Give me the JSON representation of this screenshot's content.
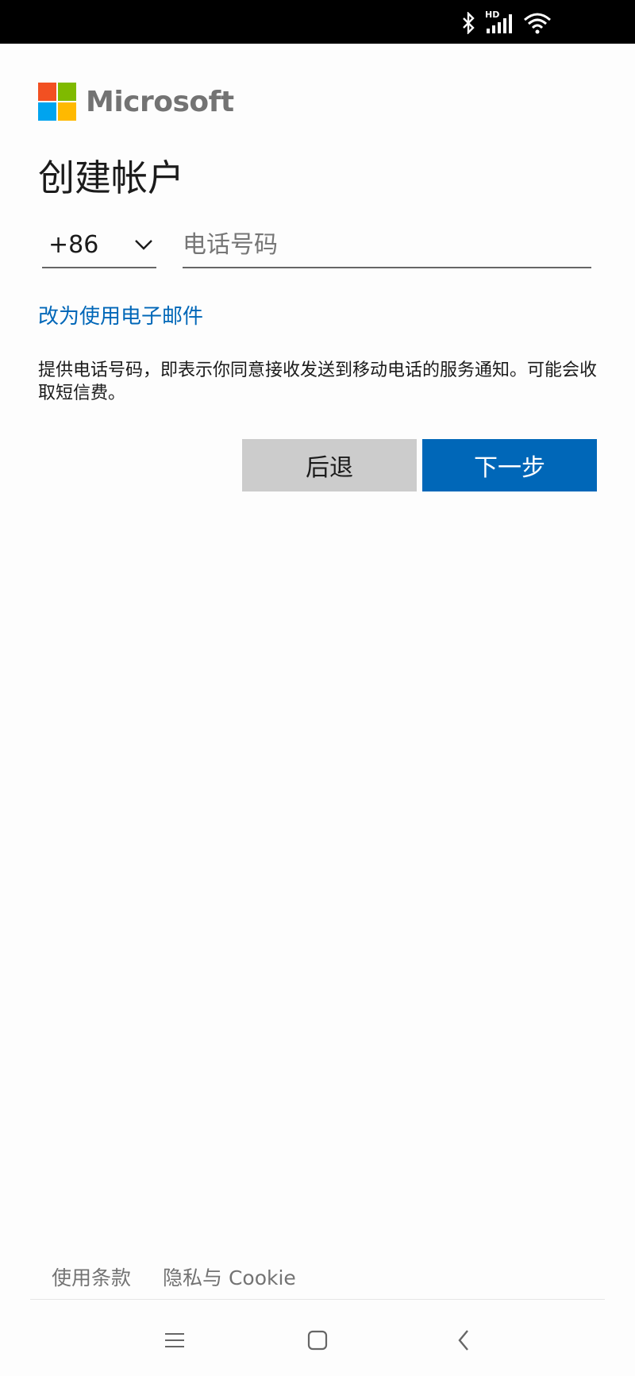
{
  "status_bar": {
    "network_label": "HD",
    "icons": [
      "bluetooth-icon",
      "signal-icon",
      "wifi-icon"
    ]
  },
  "logo": {
    "text": "Microsoft",
    "colors": [
      "#f25022",
      "#7fba00",
      "#00a4ef",
      "#ffb900"
    ]
  },
  "page": {
    "title": "创建帐户"
  },
  "form": {
    "country_code": "+86",
    "phone_placeholder": "电话号码",
    "phone_value": ""
  },
  "email_link": "改为使用电子邮件",
  "notice": "提供电话号码，即表示你同意接收发送到移动电话的服务通知。可能会收取短信费。",
  "buttons": {
    "back": "后退",
    "next": "下一步"
  },
  "footer": {
    "terms": "使用条款",
    "privacy": "隐私与 Cookie"
  },
  "colors": {
    "accent": "#0067b8",
    "secondary_button": "#cccccc"
  },
  "nav_bar": {
    "icons": [
      "menu-icon",
      "home-icon",
      "back-icon"
    ]
  }
}
